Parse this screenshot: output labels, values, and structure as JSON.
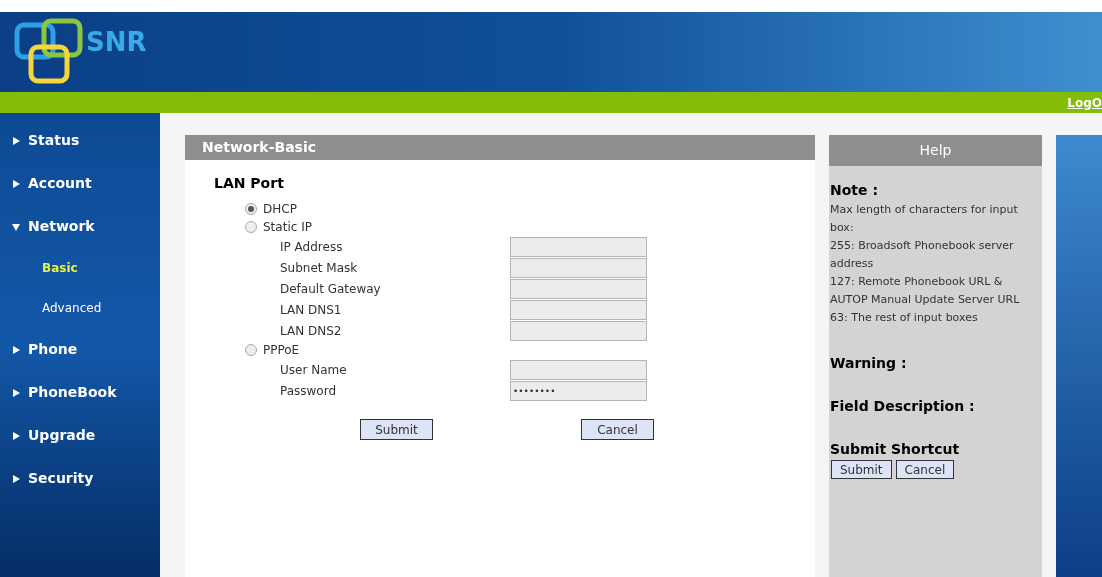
{
  "header": {
    "logo_text": "SNR",
    "logout": "LogO"
  },
  "sidebar": {
    "items": [
      {
        "label": "Status",
        "expanded": false
      },
      {
        "label": "Account",
        "expanded": false
      },
      {
        "label": "Network",
        "expanded": true,
        "children": [
          {
            "label": "Basic",
            "selected": true
          },
          {
            "label": "Advanced",
            "selected": false
          }
        ]
      },
      {
        "label": "Phone",
        "expanded": false
      },
      {
        "label": "PhoneBook",
        "expanded": false
      },
      {
        "label": "Upgrade",
        "expanded": false
      },
      {
        "label": "Security",
        "expanded": false
      }
    ]
  },
  "panel": {
    "title": "Network-Basic",
    "section": "LAN Port",
    "options": [
      {
        "label": "DHCP",
        "selected": true
      },
      {
        "label": "Static IP",
        "selected": false,
        "fields": [
          {
            "label": "IP Address"
          },
          {
            "label": "Subnet Mask"
          },
          {
            "label": "Default Gateway"
          },
          {
            "label": "LAN DNS1"
          },
          {
            "label": "LAN DNS2"
          }
        ]
      },
      {
        "label": "PPPoE",
        "selected": false,
        "fields": [
          {
            "label": "User Name"
          },
          {
            "label": "Password",
            "value": "••••••••"
          }
        ]
      }
    ],
    "buttons": [
      "Submit",
      "Cancel"
    ]
  },
  "help": {
    "title": "Help",
    "sections": [
      {
        "heading": "Note :",
        "lines": [
          "Max length of characters for input box:",
          "255: Broadsoft Phonebook server address",
          "127: Remote Phonebook URL & AUTOP Manual Update Server URL",
          "63: The rest of input boxes"
        ]
      },
      {
        "heading": "Warning :"
      },
      {
        "heading": "Field Description :"
      },
      {
        "heading": "Submit Shortcut"
      }
    ],
    "buttons": [
      "Submit",
      "Cancel"
    ]
  }
}
